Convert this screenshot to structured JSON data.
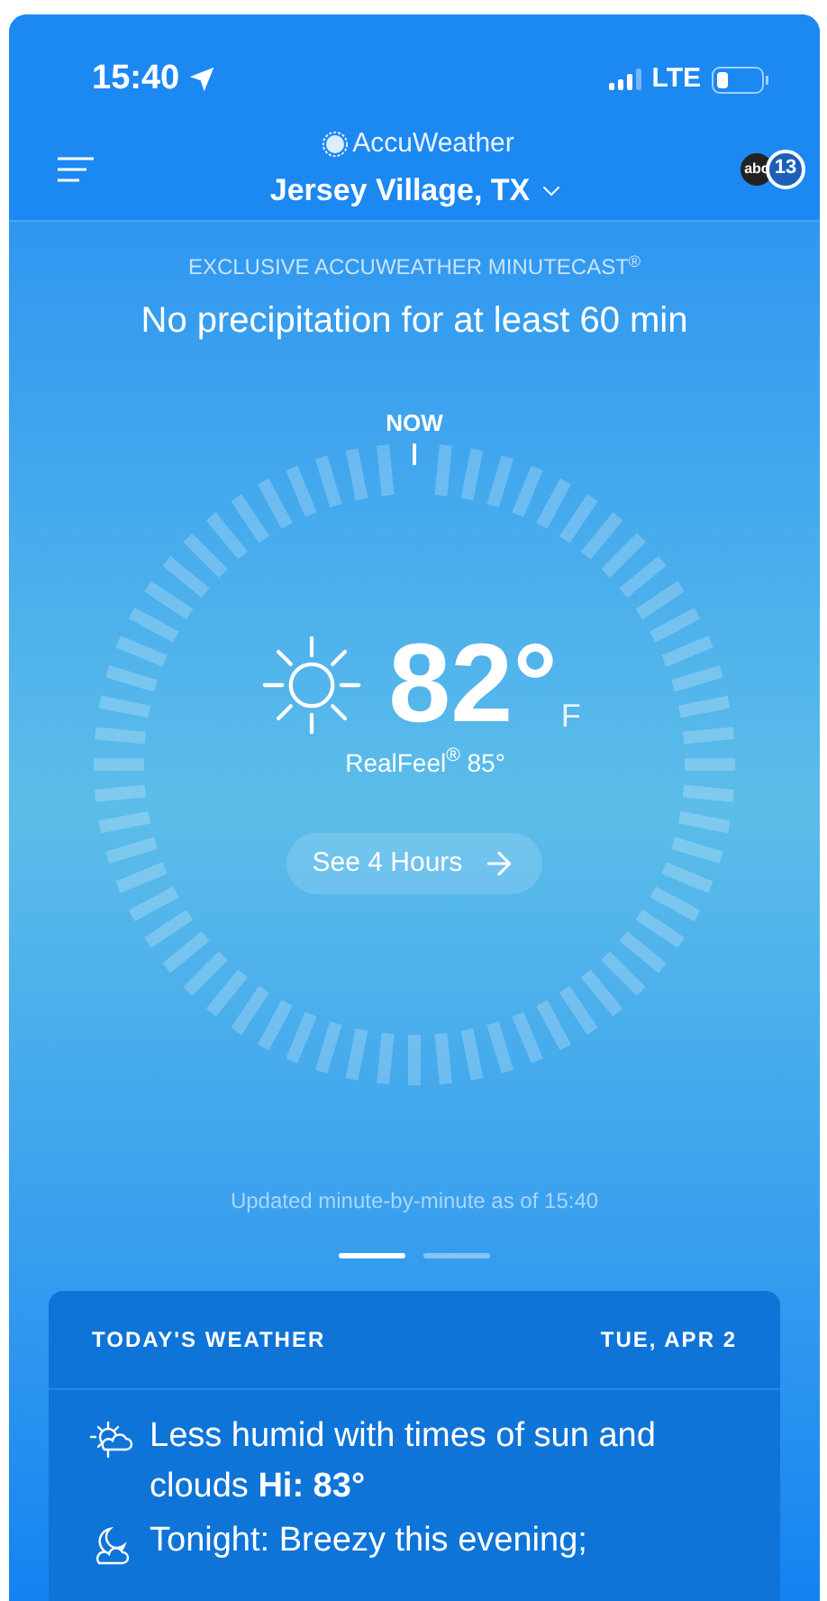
{
  "status_bar": {
    "time": "15:40",
    "network": "LTE"
  },
  "header": {
    "brand": "AccuWeather",
    "location": "Jersey Village, TX",
    "station_logo": {
      "network": "abc",
      "channel": "13"
    }
  },
  "minutecast": {
    "label": "EXCLUSIVE ACCUWEATHER MINUTECAST$^{®}$",
    "headline": "No precipitation for at least 60 min"
  },
  "dial": {
    "marker": "NOW",
    "temperature": "82°",
    "unit": "F",
    "realfeel": "RealFeel$^{®}$ 85°",
    "button": "See 4 Hours",
    "updated": "Updated minute-by-minute as of 15:40"
  },
  "pages": [
    {
      "selected": true
    },
    {
      "selected": false
    }
  ],
  "today": {
    "title": "TODAY'S WEATHER",
    "date": "TUE, APR 2",
    "items": [
      {
        "kind": "day",
        "text": "Less humid with times of sun and clouds **Hi: 83°**"
      },
      {
        "kind": "night",
        "text": "Tonight: Breezy this evening;"
      }
    ]
  }
}
